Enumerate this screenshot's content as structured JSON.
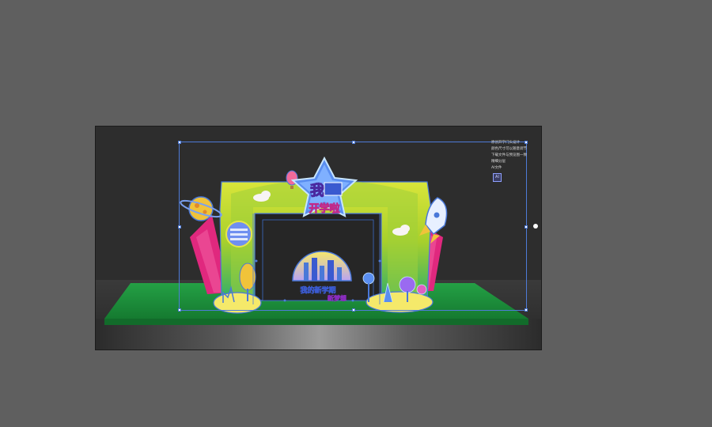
{
  "canvas": {
    "background_color": "#5f5f5f",
    "artboard_color": "#2d2d2d",
    "selection_color": "#4e7bd8"
  },
  "notes": {
    "lines": [
      "原创开学门头设计",
      "颜色尺寸可以随意调节",
      "下载文件与预览图一致",
      "精细分层",
      "AI文件"
    ],
    "badge_label": "AI"
  },
  "design": {
    "star_sign_line1": "我",
    "star_sign_line2": "开学啦",
    "center_sign_line1": "我的新学期",
    "center_sign_line2": "新梦想",
    "icons": [
      "planet-icon",
      "hot-air-balloon-icon",
      "rocket-icon",
      "cloud-icon",
      "tree-icon"
    ],
    "colors": {
      "arch_green": "#b8d62a",
      "arch_yellow": "#e6e64a",
      "magenta": "#e0287e",
      "blue": "#4a78d8",
      "floor_green": "#1f8a3a"
    }
  }
}
